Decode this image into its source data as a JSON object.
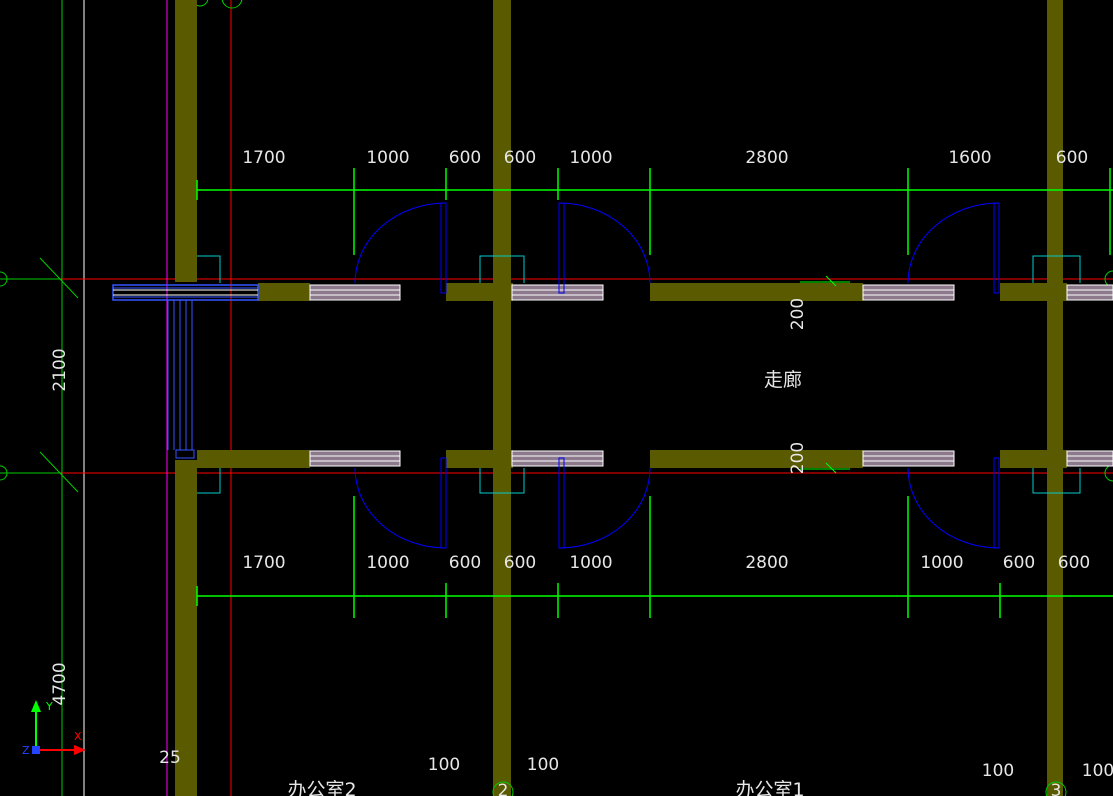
{
  "drawing": {
    "top_dimensions": [
      "1700",
      "1000",
      "600",
      "600",
      "1000",
      "2800",
      "1600",
      "600"
    ],
    "bottom_dimensions": [
      "1700",
      "1000",
      "600",
      "600",
      "1000",
      "2800",
      "1000",
      "600",
      "600"
    ],
    "left_vertical_dims": [
      "2100",
      "4700"
    ],
    "corridor_labels": [
      "200",
      "200"
    ],
    "room_labels": {
      "corridor": "走廊",
      "office_2": "办公室2",
      "office_1": "办公室1"
    },
    "small_numbers": [
      "25",
      "100",
      "100",
      "100",
      "100"
    ],
    "axis_markers": [
      "2",
      "3"
    ],
    "ucs": {
      "x_label": "X",
      "y_label": "Y",
      "z_label": "Z"
    },
    "colors": {
      "background": "#000000",
      "wall_fill": "#5a5a00",
      "dimension_lines": "#00ff00",
      "axis_lines": "#ff0000",
      "door_arcs": "#0000ff",
      "window": "#ffffff",
      "window_selected": "#3333ff",
      "pink_line": "#ff00ff"
    }
  }
}
